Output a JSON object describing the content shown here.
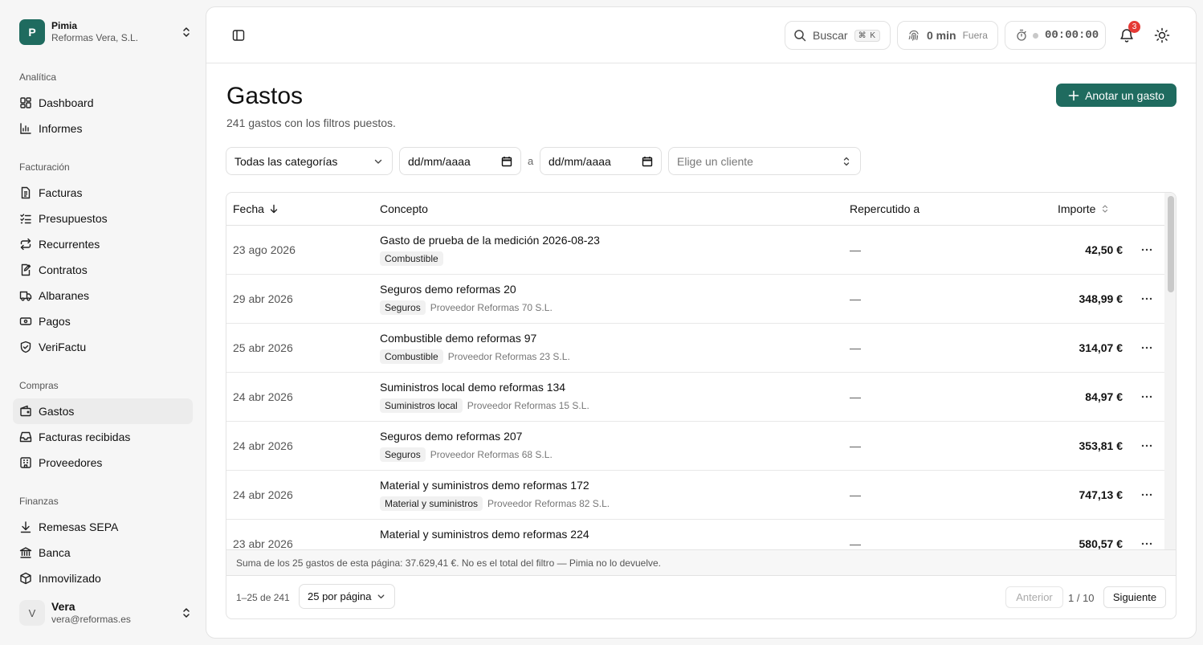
{
  "org": {
    "logo_letter": "P",
    "name": "Pimia",
    "company": "Reformas Vera, S.L."
  },
  "sidebar": {
    "sections": [
      {
        "label": "Analítica",
        "items": [
          "Dashboard",
          "Informes"
        ]
      },
      {
        "label": "Facturación",
        "items": [
          "Facturas",
          "Presupuestos",
          "Recurrentes",
          "Contratos",
          "Albaranes",
          "Pagos",
          "VeriFactu"
        ]
      },
      {
        "label": "Compras",
        "items": [
          "Gastos",
          "Facturas recibidas",
          "Proveedores"
        ]
      },
      {
        "label": "Finanzas",
        "items": [
          "Remesas SEPA",
          "Banca",
          "Inmovilizado"
        ]
      }
    ],
    "active_item": "Gastos"
  },
  "user": {
    "initial": "V",
    "name": "Vera",
    "email": "vera@reformas.es"
  },
  "topbar": {
    "search_label": "Buscar",
    "search_shortcut": "⌘ K",
    "clock_minutes": "0 min",
    "clock_status": "Fuera",
    "timer": "00:00:00",
    "notifications_count": "3"
  },
  "page": {
    "title": "Gastos",
    "subtitle": "241 gastos con los filtros puestos.",
    "add_button": "Anotar un gasto"
  },
  "filters": {
    "category": "Todas las categorías",
    "date_from_placeholder": "dd/mm/aaaa",
    "date_separator": "a",
    "date_to_placeholder": "dd/mm/aaaa",
    "client_placeholder": "Elige un cliente"
  },
  "table": {
    "columns": {
      "date": "Fecha",
      "concept": "Concepto",
      "charged_to": "Repercutido a",
      "amount": "Importe"
    },
    "rows": [
      {
        "date": "23 ago 2026",
        "concept": "Gasto de prueba de la medición 2026-08-23",
        "category": "Combustible",
        "provider": "",
        "charged_to": "—",
        "amount": "42,50 €"
      },
      {
        "date": "29 abr 2026",
        "concept": "Seguros demo reformas 20",
        "category": "Seguros",
        "provider": "Proveedor Reformas 70 S.L.",
        "charged_to": "—",
        "amount": "348,99 €"
      },
      {
        "date": "25 abr 2026",
        "concept": "Combustible demo reformas 97",
        "category": "Combustible",
        "provider": "Proveedor Reformas 23 S.L.",
        "charged_to": "—",
        "amount": "314,07 €"
      },
      {
        "date": "24 abr 2026",
        "concept": "Suministros local demo reformas 134",
        "category": "Suministros local",
        "provider": "Proveedor Reformas 15 S.L.",
        "charged_to": "—",
        "amount": "84,97 €"
      },
      {
        "date": "24 abr 2026",
        "concept": "Seguros demo reformas 207",
        "category": "Seguros",
        "provider": "Proveedor Reformas 68 S.L.",
        "charged_to": "—",
        "amount": "353,81 €"
      },
      {
        "date": "24 abr 2026",
        "concept": "Material y suministros demo reformas 172",
        "category": "Material y suministros",
        "provider": "Proveedor Reformas 82 S.L.",
        "charged_to": "—",
        "amount": "747,13 €"
      },
      {
        "date": "23 abr 2026",
        "concept": "Material y suministros demo reformas 224",
        "category": "",
        "provider": "",
        "charged_to": "—",
        "amount": "580,57 €"
      }
    ],
    "sum_note": "Suma de los 25 gastos de esta página: 37.629,41 €. No es el total del filtro — Pimia no lo devuelve."
  },
  "pagination": {
    "range": "1–25 de 241",
    "per_page": "25 por página",
    "prev": "Anterior",
    "page": "1 / 10",
    "next": "Siguiente"
  },
  "colors": {
    "accent": "#1f6b5f",
    "badge": "#e53935"
  }
}
